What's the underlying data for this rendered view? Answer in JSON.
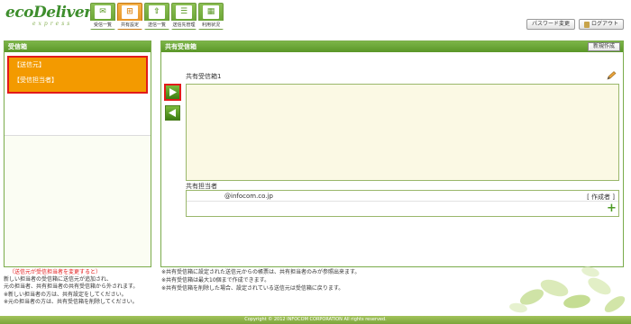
{
  "logo": {
    "main": "ecoDeliver",
    "sub": "express"
  },
  "nav": [
    {
      "label": "受信一覧",
      "icon": "envelope-icon",
      "active": false
    },
    {
      "label": "共有設定",
      "icon": "share-settings-icon",
      "active": true
    },
    {
      "label": "送信一覧",
      "icon": "upload-icon",
      "active": false
    },
    {
      "label": "送信先管理",
      "icon": "address-book-icon",
      "active": false
    },
    {
      "label": "利用状況",
      "icon": "usage-icon",
      "active": false
    }
  ],
  "header": {
    "password_change": "パスワード変更",
    "logout": "ログアウト"
  },
  "left_panel": {
    "title": "受信箱",
    "sender_label": "【送信元】",
    "recipient_label": "【受信担当者】"
  },
  "right_panel": {
    "title": "共有受信箱",
    "new_button": "新規作成",
    "box_name": "共有受信箱1",
    "share_label": "共有担当者",
    "share_email": "@infocom.co.jp",
    "share_role": "[ 作成者 ]"
  },
  "notes_left": [
    "（送信元が受信担当者を変更すると）",
    "新しい担当者の受信箱に送信元が追加され、",
    "元の担当者、共有担当者の共有受信箱から外されます。",
    "※新しい担当者の方は、共有設定をしてください。",
    "※元の担当者の方は、共有受信箱を削除してください。"
  ],
  "notes_right": [
    "※共有受信箱に設定された送信元からの帳票は、共有担当者のみが参照出来ます。",
    "※共有受信箱は最大10個まで作成できます。",
    "※共有受信箱を削除した場合、設定されている送信元は受信箱に戻ります。"
  ],
  "footer": "Copyright © 2012 INFOCOM CORPORATION All rights reserved.",
  "colors": {
    "accent_green": "#6aa637",
    "orange": "#f39a00",
    "highlight_red": "#e21a1a"
  }
}
